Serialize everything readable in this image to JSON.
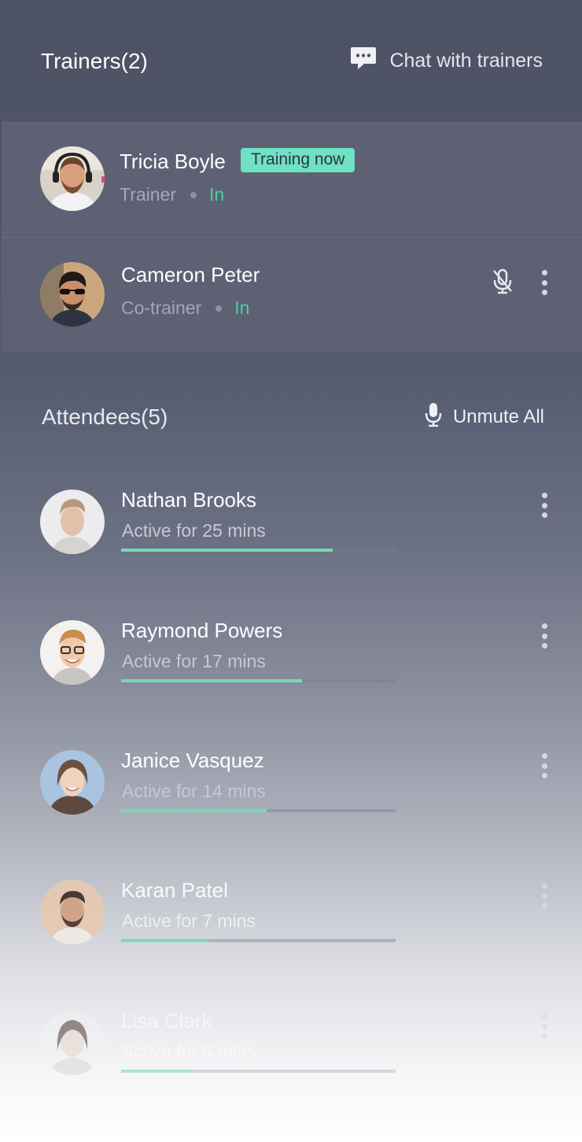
{
  "trainers": {
    "title": "Trainers(2)",
    "chat_label": "Chat with trainers",
    "chat_icon": "chat-bubble-icon",
    "items": [
      {
        "name": "Tricia Boyle",
        "role": "Trainer",
        "status": "In",
        "badge": "Training now"
      },
      {
        "name": "Cameron Peter",
        "role": "Co-trainer",
        "status": "In",
        "mic_icon": "mic-muted-icon",
        "menu_icon": "more-vertical-icon"
      }
    ]
  },
  "attendees": {
    "title": "Attendees(5)",
    "unmute_label": "Unmute All",
    "unmute_icon": "microphone-icon",
    "items": [
      {
        "name": "Nathan Brooks",
        "activity": "Active for 25 mins",
        "progress": 0.77
      },
      {
        "name": "Raymond Powers",
        "activity": "Active for 17 mins",
        "progress": 0.66
      },
      {
        "name": "Janice Vasquez",
        "activity": "Active for 14 mins",
        "progress": 0.53
      },
      {
        "name": "Karan Patel",
        "activity": "Active for 7 mins",
        "progress": 0.32
      },
      {
        "name": "Lisa Clark",
        "activity": "Active for 5 mins",
        "progress": 0.26
      }
    ]
  },
  "colors": {
    "accent_green": "#4fcf9b",
    "badge_bg": "#6fe1c4",
    "progress_fill": "#6fdcb0"
  }
}
